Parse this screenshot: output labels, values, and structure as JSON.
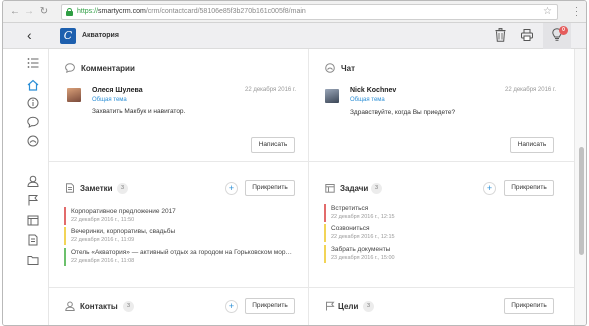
{
  "browser": {
    "back_glyph": "←",
    "forward_glyph": "→",
    "reload_glyph": "↻",
    "url_scheme": "https://",
    "url_host": "smartycrm.com",
    "url_path": "/crm/contactcard/58106e85f3b270b161c005f8/main"
  },
  "header": {
    "back_glyph": "‹",
    "logo_letter": "C",
    "title": "Акватория",
    "notification_count": "0"
  },
  "comments": {
    "title": "Комментарии",
    "author": "Олеся Шулева",
    "topic": "Общая тема",
    "date": "22 декабря 2016 г.",
    "text": "Захватить Макбук и навигатор.",
    "button": "Написать"
  },
  "chat": {
    "title": "Чат",
    "author": "Nick Kochnev",
    "topic": "Общая тема",
    "date": "22 декабря 2016 г.",
    "text": "Здравствуйте, когда Вы приедете?",
    "button": "Написать"
  },
  "notes": {
    "title": "Заметки",
    "count": "3",
    "plus": "+",
    "button": "Прикрепить",
    "items": [
      {
        "text": "Корпоративное предложение 2017",
        "date": "22 декабря 2016 г., 11:50",
        "color": "#e26b6b"
      },
      {
        "text": "Вечеринки, корпоративы, свадьбы",
        "date": "22 декабря 2016 г., 11:09",
        "color": "#f2d457"
      },
      {
        "text": "Отель «Акватория» — активный отдых за городом на Горьковском мор…",
        "date": "22 декабря 2016 г., 11:08",
        "color": "#6cc06c"
      }
    ]
  },
  "tasks": {
    "title": "Задачи",
    "count": "3",
    "plus": "+",
    "button": "Прикрепить",
    "items": [
      {
        "text": "Встретиться",
        "date": "22 декабря 2016 г., 12:15",
        "color": "#e26b6b"
      },
      {
        "text": "Созвониться",
        "date": "22 декабря 2016 г., 12:15",
        "color": "#f2d457"
      },
      {
        "text": "Забрать документы",
        "date": "23 декабря 2016 г., 15:00",
        "color": "#f2d457"
      }
    ]
  },
  "contacts": {
    "title": "Контакты",
    "count": "3",
    "plus": "+",
    "button": "Прикрепить"
  },
  "goals": {
    "title": "Цели",
    "count": "3",
    "button": "Прикрепить"
  },
  "colors": {
    "accent": "#2c8fd6",
    "logo_bg": "#1d5fae",
    "badge": "#e55b5b"
  }
}
